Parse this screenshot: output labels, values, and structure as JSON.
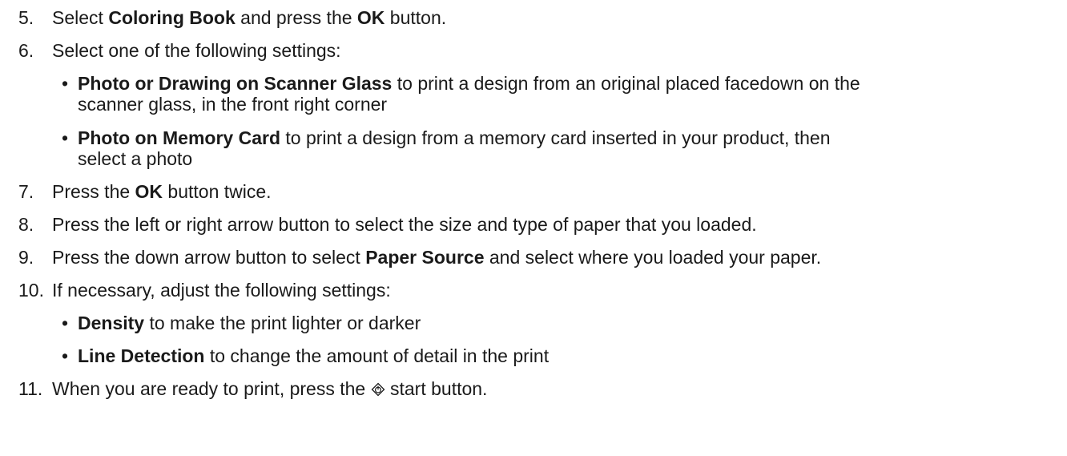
{
  "steps": [
    {
      "number": "5.",
      "parts": [
        {
          "t": "Select "
        },
        {
          "b": "Coloring Book"
        },
        {
          "t": " and press the "
        },
        {
          "b": "OK"
        },
        {
          "t": " button."
        }
      ]
    },
    {
      "number": "6.",
      "parts": [
        {
          "t": "Select one of the following settings:"
        }
      ],
      "bullets": [
        {
          "bold": "Photo or Drawing on Scanner Glass",
          "line1": " to print a design from an original placed facedown on the",
          "line2": "scanner glass, in the front right corner"
        },
        {
          "bold": "Photo on Memory Card",
          "line1": " to print a design from a memory card inserted in your product, then",
          "line2": "select a photo"
        }
      ]
    },
    {
      "number": "7.",
      "parts": [
        {
          "t": "Press the "
        },
        {
          "b": "OK"
        },
        {
          "t": " button twice."
        }
      ]
    },
    {
      "number": "8.",
      "parts": [
        {
          "t": "Press the left or right arrow button to select the size and type of paper that you loaded."
        }
      ]
    },
    {
      "number": "9.",
      "parts": [
        {
          "t": "Press the down arrow button to select "
        },
        {
          "b": "Paper Source"
        },
        {
          "t": " and select where you loaded your paper."
        }
      ]
    },
    {
      "number": "10.",
      "parts": [
        {
          "t": "If necessary, adjust the following settings:"
        }
      ],
      "bullets": [
        {
          "bold": "Density",
          "line1": " to make the print lighter or darker"
        },
        {
          "bold": "Line Detection",
          "line1": " to change the amount of detail in the print"
        }
      ]
    },
    {
      "number": "11.",
      "parts": [
        {
          "t": "When you are ready to print, press the "
        },
        {
          "icon": "start-icon"
        },
        {
          "t": " start button."
        }
      ]
    }
  ],
  "bullet_char": "•",
  "colors": {
    "text": "#1a1a1a"
  }
}
